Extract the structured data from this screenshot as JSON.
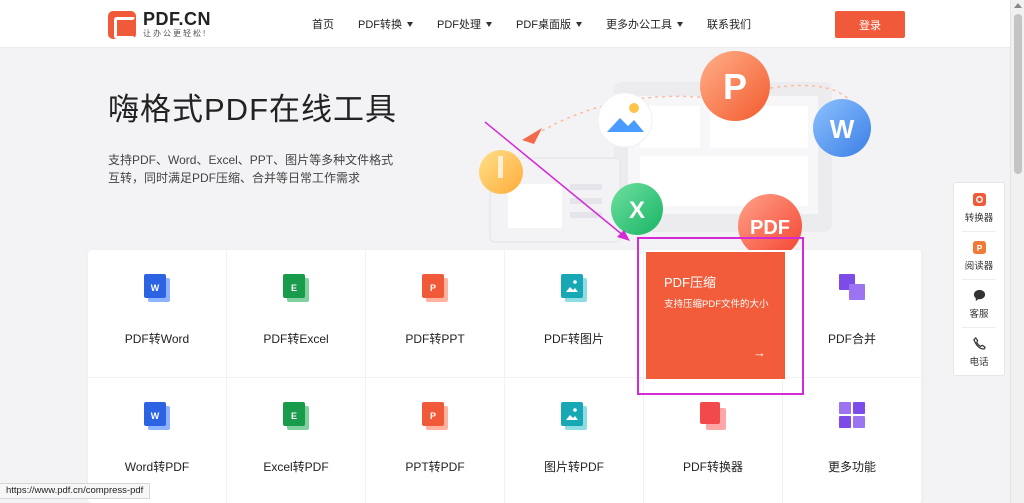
{
  "brand": {
    "name": "PDF.CN",
    "slogan": "让办公更轻松!"
  },
  "nav": [
    {
      "label": "首页"
    },
    {
      "label": "PDF转换"
    },
    {
      "label": "PDF处理"
    },
    {
      "label": "PDF桌面版"
    },
    {
      "label": "更多办公工具"
    },
    {
      "label": "联系我们"
    }
  ],
  "login_label": "登录",
  "hero": {
    "title": "嗨格式PDF在线工具",
    "desc_line1": "支持PDF、Word、Excel、PPT、图片等多种文件格式",
    "desc_line2": "互转，同时满足PDF压缩、合并等日常工作需求"
  },
  "tools_row1": [
    {
      "label": "PDF转Word"
    },
    {
      "label": "PDF转Excel"
    },
    {
      "label": "PDF转PPT"
    },
    {
      "label": "PDF转图片"
    },
    {
      "label": "PDF压缩"
    },
    {
      "label": "PDF合并"
    }
  ],
  "tools_row2": [
    {
      "label": "Word转PDF"
    },
    {
      "label": "Excel转PDF"
    },
    {
      "label": "PPT转PDF"
    },
    {
      "label": "图片转PDF"
    },
    {
      "label": "PDF转换器"
    },
    {
      "label": "更多功能"
    }
  ],
  "active_tool": {
    "title": "PDF压缩",
    "desc": "支持压缩PDF文件的大小",
    "arrow": "→"
  },
  "side": [
    {
      "label": "转换器"
    },
    {
      "label": "阅读器"
    },
    {
      "label": "客服"
    },
    {
      "label": "电话"
    }
  ],
  "hero_art_letters": {
    "p": "P",
    "w": "W",
    "x": "X",
    "pdf": "PDF"
  },
  "status_url": "https://www.pdf.cn/compress-pdf",
  "colors": {
    "accent": "#f05a38",
    "highlight": "#d42bd6",
    "word": "#2b63e3",
    "excel": "#1a9a4b",
    "ppt": "#f05a38",
    "image": "#18a7b5",
    "merge": "#7c4be8"
  }
}
